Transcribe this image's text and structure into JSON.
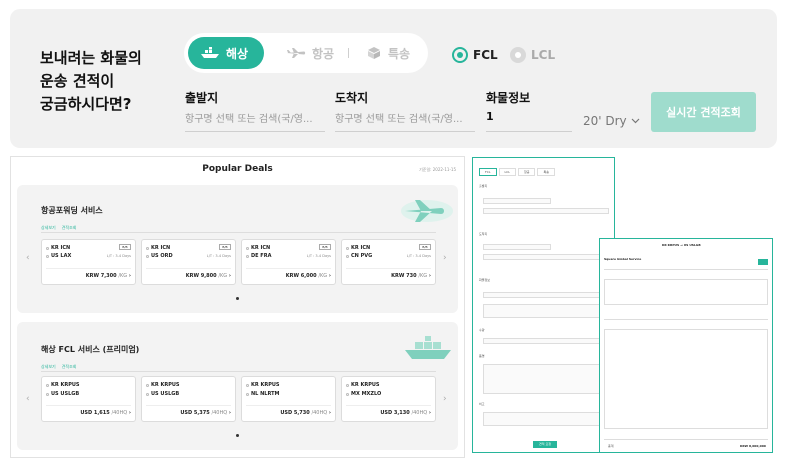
{
  "search": {
    "headline": [
      "보내려는 화물의",
      "운송 견적이",
      "궁금하시다면?"
    ],
    "modes": [
      {
        "label": "해상",
        "icon": "ship-icon",
        "active": true
      },
      {
        "label": "항공",
        "icon": "plane-icon",
        "active": false
      },
      {
        "label": "특송",
        "icon": "box-icon",
        "active": false
      }
    ],
    "load_types": [
      {
        "label": "FCL",
        "selected": true
      },
      {
        "label": "LCL",
        "selected": false
      }
    ],
    "origin": {
      "label": "출발지",
      "placeholder": "항구명 선택 또는 검색(국/영..."
    },
    "destination": {
      "label": "도착지",
      "placeholder": "항구명 선택 또는 검색(국/영..."
    },
    "cargo": {
      "label": "화물정보",
      "quantity": "1",
      "unit": "20' Dry"
    },
    "quote_button": "실시간 견적조회",
    "accent_color": "#27b59b"
  },
  "deals": {
    "title": "Popular Deals",
    "date": "기준일: 2022-11-15",
    "sections": [
      {
        "name": "항공포워딩 서비스",
        "links": [
          "상세보기",
          "견적조회"
        ],
        "cards": [
          {
            "from": "KR ICN",
            "to": "US LAX",
            "lt": "L/T : 3-4 Days",
            "badge": "B/B",
            "price": "KRW 7,300",
            "unit": "/KG"
          },
          {
            "from": "KR ICN",
            "to": "US ORD",
            "lt": "L/T : 3-4 Days",
            "badge": "B/B",
            "price": "KRW 9,800",
            "unit": "/KG"
          },
          {
            "from": "KR ICN",
            "to": "DE FRA",
            "lt": "L/T : 3-4 Days",
            "badge": "B/B",
            "price": "KRW 6,000",
            "unit": "/KG"
          },
          {
            "from": "KR ICN",
            "to": "CN PVG",
            "lt": "L/T : 3-4 Days",
            "badge": "B/B",
            "price": "KRW 730",
            "unit": "/KG"
          }
        ]
      },
      {
        "name": "해상 FCL 서비스 (프리미엄)",
        "links": [
          "상세보기",
          "견적조회"
        ],
        "cards": [
          {
            "from": "KR KRPUS",
            "to": "US USLGB",
            "price": "USD 1,615",
            "unit": "/40HQ"
          },
          {
            "from": "KR KRPUS",
            "to": "US USLGB",
            "price": "USD 5,375",
            "unit": "/40HQ"
          },
          {
            "from": "KR KRPUS",
            "to": "NL NLRTM",
            "price": "USD 5,730",
            "unit": "/40HQ"
          },
          {
            "from": "KR KRPUS",
            "to": "MX MXZLO",
            "price": "USD 3,130",
            "unit": "/40HQ"
          }
        ]
      }
    ]
  },
  "form_panel": {
    "tabs": [
      "FCL",
      "LCL",
      "항공",
      "특송"
    ],
    "fields": [
      "출발지",
      "도착지",
      "화물정보",
      "수량",
      "품명",
      "비고"
    ],
    "submit": "견적 요청"
  },
  "result_panel": {
    "route": "KR KRPUS → US USLGB",
    "company": "Square Global Service",
    "total_label": "총계",
    "total_value": "KRW 8,000,000"
  }
}
